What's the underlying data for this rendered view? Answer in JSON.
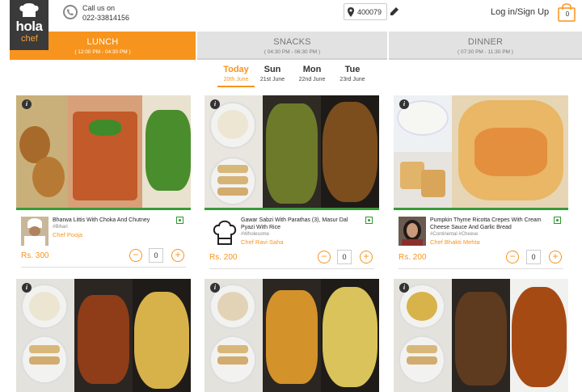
{
  "header": {
    "logo_top": "hola",
    "logo_bottom": "chef",
    "call_label": "Call us on",
    "phone": "022-33814156",
    "pincode": "400079",
    "login_label": "Log in/Sign Up",
    "cart_count": "0"
  },
  "tabs": [
    {
      "name": "LUNCH",
      "time": "( 12:00 PM - 04:30 PM )",
      "active": true
    },
    {
      "name": "SNACKS",
      "time": "( 04:30 PM - 06:30 PM )",
      "active": false
    },
    {
      "name": "DINNER",
      "time": "( 07:30 PM - 11:30 PM )",
      "active": false
    }
  ],
  "days": [
    {
      "name": "Today",
      "date": "20th June",
      "active": true
    },
    {
      "name": "Sun",
      "date": "21st June",
      "active": false
    },
    {
      "name": "Mon",
      "date": "22nd June",
      "active": false
    },
    {
      "name": "Tue",
      "date": "23rd June",
      "active": false
    }
  ],
  "cards": [
    {
      "dish": "Bharwa Littis With Choka And Chutney",
      "tag": "#Bihari",
      "chef": "Chef Pooja",
      "price": "Rs. 300",
      "qty": "0"
    },
    {
      "dish": "Gawar Sabzi With Parathas (3), Masur Dal Pyazi With Rice",
      "tag": "#Wholesome",
      "chef": "Chef Ravi Saha",
      "price": "Rs. 200",
      "qty": "0"
    },
    {
      "dish": "Pumpkin Thyme Ricotta Crepes With Cream Cheese Sauce And Garlic Bread",
      "tag": "#Continental #Cheese",
      "chef": "Chef Bhakti Mehta",
      "price": "Rs. 200",
      "qty": "0"
    }
  ],
  "colors": {
    "accent": "#f7941d",
    "veg_green": "#3a9a3a",
    "tab_inactive": "#e2e2e2"
  }
}
